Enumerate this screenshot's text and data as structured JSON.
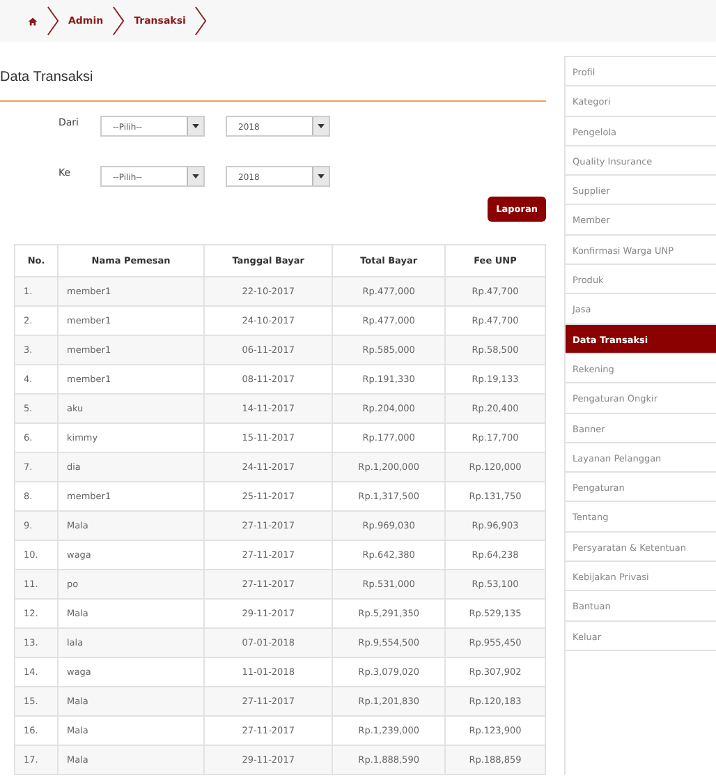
{
  "breadcrumb": {
    "items": [
      "Admin",
      "Transaksi"
    ]
  },
  "title": "Data Transaksi",
  "filters": [
    {
      "label": "Dari",
      "month": "--Pilih--",
      "year": "2018"
    },
    {
      "label": "Ke",
      "month": "--Pilih--",
      "year": "2018"
    }
  ],
  "report_button": "Laporan",
  "table": {
    "columns": [
      "No.",
      "Nama Pemesan",
      "Tanggal Bayar",
      "Total Bayar",
      "Fee UNP"
    ],
    "rows": [
      [
        "1.",
        "member1",
        "22-10-2017",
        "Rp.477,000",
        "Rp.47,700"
      ],
      [
        "2.",
        "member1",
        "24-10-2017",
        "Rp.477,000",
        "Rp.47,700"
      ],
      [
        "3.",
        "member1",
        "06-11-2017",
        "Rp.585,000",
        "Rp.58,500"
      ],
      [
        "4.",
        "member1",
        "08-11-2017",
        "Rp.191,330",
        "Rp.19,133"
      ],
      [
        "5.",
        "aku",
        "14-11-2017",
        "Rp.204,000",
        "Rp.20,400"
      ],
      [
        "6.",
        "kimmy",
        "15-11-2017",
        "Rp.177,000",
        "Rp.17,700"
      ],
      [
        "7.",
        "dia",
        "24-11-2017",
        "Rp.1,200,000",
        "Rp.120,000"
      ],
      [
        "8.",
        "member1",
        "25-11-2017",
        "Rp.1,317,500",
        "Rp.131,750"
      ],
      [
        "9.",
        "Mala",
        "27-11-2017",
        "Rp.969,030",
        "Rp.96,903"
      ],
      [
        "10.",
        "waga",
        "27-11-2017",
        "Rp.642,380",
        "Rp.64,238"
      ],
      [
        "11.",
        "po",
        "27-11-2017",
        "Rp.531,000",
        "Rp.53,100"
      ],
      [
        "12.",
        "Mala",
        "29-11-2017",
        "Rp.5,291,350",
        "Rp.529,135"
      ],
      [
        "13.",
        "lala",
        "07-01-2018",
        "Rp.9,554,500",
        "Rp.955,450"
      ],
      [
        "14.",
        "waga",
        "11-01-2018",
        "Rp.3,079,020",
        "Rp.307,902"
      ],
      [
        "15.",
        "Mala",
        "27-11-2017",
        "Rp.1,201,830",
        "Rp.120,183"
      ],
      [
        "16.",
        "Mala",
        "27-11-2017",
        "Rp.1,239,000",
        "Rp.123,900"
      ],
      [
        "17.",
        "Mala",
        "29-11-2017",
        "Rp.1,888,590",
        "Rp.188,859"
      ]
    ]
  },
  "sidebar": {
    "items": [
      {
        "label": "Profil",
        "selected": false
      },
      {
        "label": "Kategori",
        "selected": false
      },
      {
        "label": "Pengelola",
        "selected": false
      },
      {
        "label": "Quality Insurance",
        "selected": false
      },
      {
        "label": "Supplier",
        "selected": false
      },
      {
        "label": "Member",
        "selected": false
      },
      {
        "label": "Konfirmasi Warga UNP",
        "selected": false
      },
      {
        "label": "Produk",
        "selected": false
      },
      {
        "label": "Jasa",
        "selected": false
      },
      {
        "label": "Data Transaksi",
        "selected": true
      },
      {
        "label": "Rekening",
        "selected": false
      },
      {
        "label": "Pengaturan Ongkir",
        "selected": false
      },
      {
        "label": "Banner",
        "selected": false
      },
      {
        "label": "Layanan Pelanggan",
        "selected": false
      },
      {
        "label": "Pengaturan",
        "selected": false
      },
      {
        "label": "Tentang",
        "selected": false
      },
      {
        "label": "Persyaratan & Ketentuan",
        "selected": false
      },
      {
        "label": "Kebijakan Privasi",
        "selected": false
      },
      {
        "label": "Bantuan",
        "selected": false
      },
      {
        "label": "Keluar",
        "selected": false
      }
    ]
  }
}
